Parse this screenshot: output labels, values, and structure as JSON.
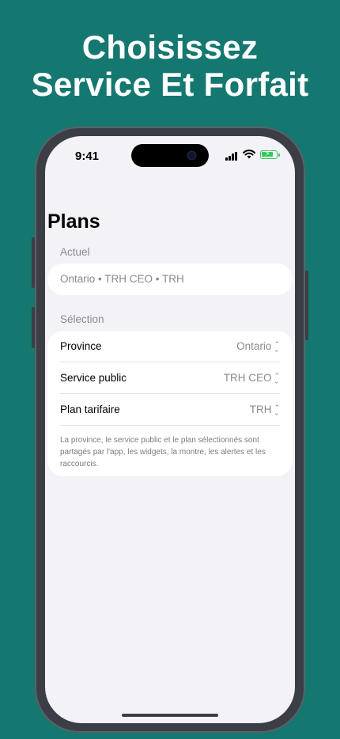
{
  "headline": {
    "line1": "Choisissez",
    "line2": "Service Et Forfait"
  },
  "status_bar": {
    "time": "9:41",
    "icons": [
      "signal-icon",
      "wifi-icon",
      "battery-charging-icon"
    ],
    "battery_color": "#34c759"
  },
  "page": {
    "title": "Plans"
  },
  "current": {
    "header": "Actuel",
    "summary": "Ontario • TRH CEO • TRH"
  },
  "selection": {
    "header": "Sélection",
    "rows": [
      {
        "label": "Province",
        "value": "Ontario"
      },
      {
        "label": "Service public",
        "value": "TRH CEO"
      },
      {
        "label": "Plan tarifaire",
        "value": "TRH"
      }
    ],
    "footer": "La province, le service public et le plan sélectionnés sont partagés par l'app, les widgets, la montre, les alertes et les raccourcis."
  },
  "colors": {
    "background": "#157870",
    "screen": "#f2f2f7",
    "card": "#ffffff",
    "secondary_text": "#8a8a8e"
  }
}
